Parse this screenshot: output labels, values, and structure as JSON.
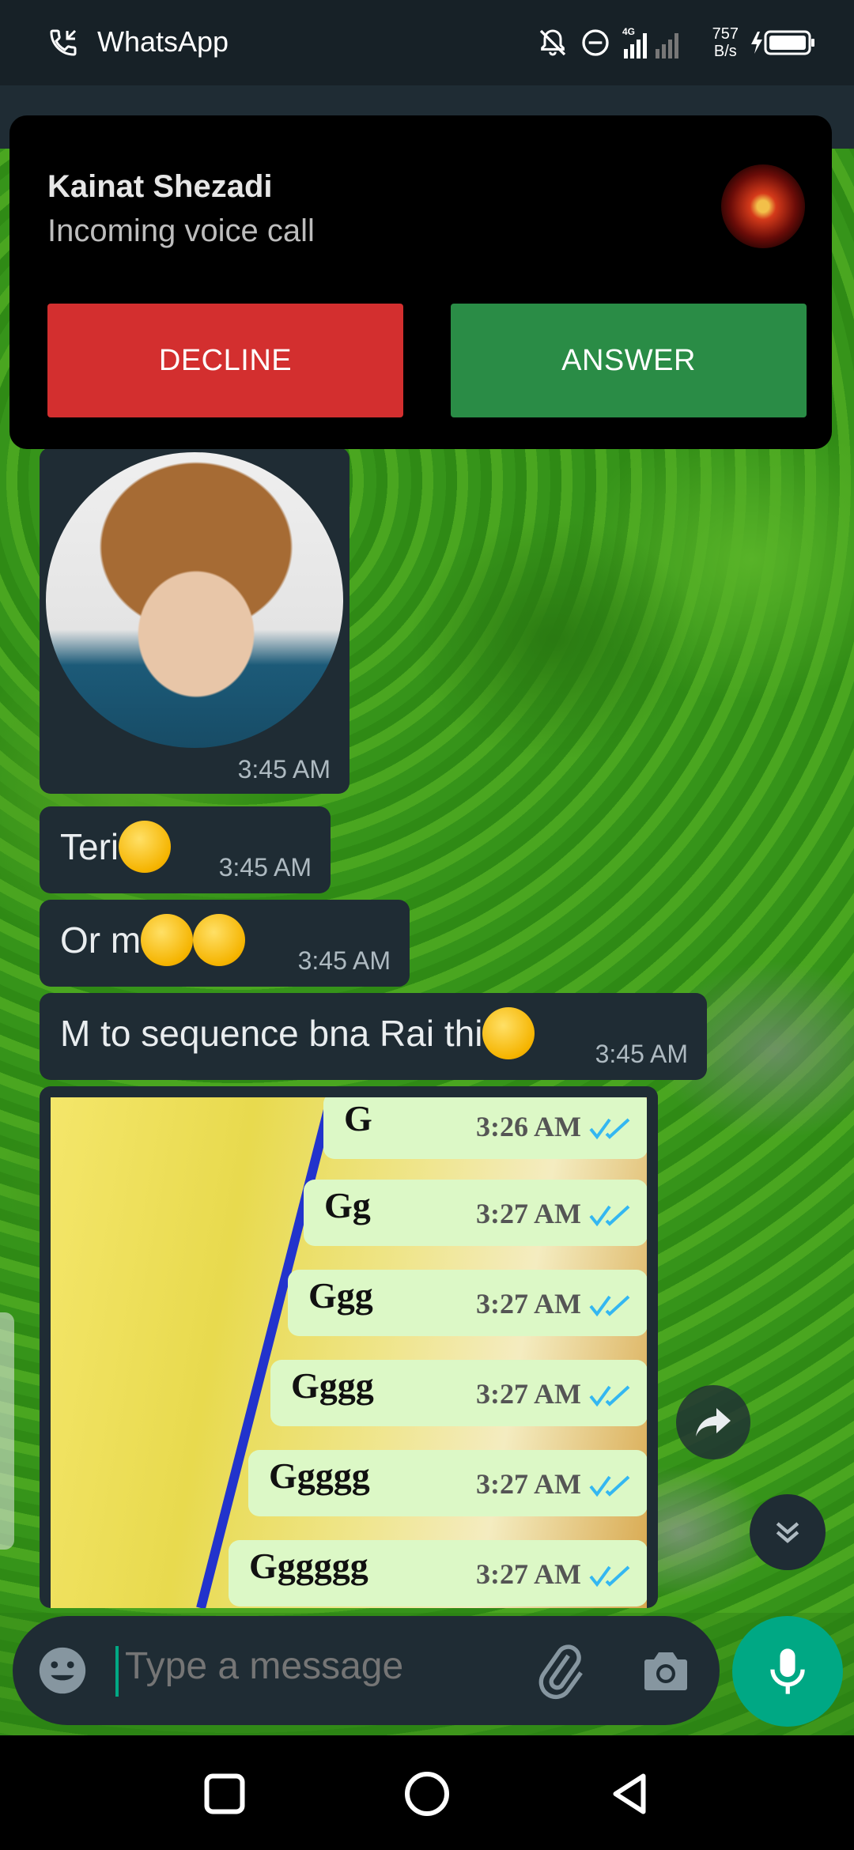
{
  "status_bar": {
    "app_name": "WhatsApp",
    "network_type": "4G",
    "net_speed_value": "757",
    "net_speed_unit": "B/s",
    "icons": [
      "missed-call-icon",
      "silent-bell-icon",
      "do-not-disturb-icon",
      "signal-icon",
      "battery-charging-icon"
    ]
  },
  "call_notification": {
    "caller_name": "Kainat Shezadi",
    "subtitle": "Incoming voice call",
    "decline_label": "DECLINE",
    "answer_label": "ANSWER",
    "colors": {
      "decline": "#d32f2f",
      "answer": "#2a8c46"
    }
  },
  "messages": [
    {
      "type": "sticker",
      "time": "3:45 AM"
    },
    {
      "type": "text",
      "text": "Teri",
      "emoji": "raised-eyebrow-emoji",
      "time": "3:45 AM"
    },
    {
      "type": "text",
      "text": "Or m",
      "emoji": "laughing-emoji",
      "time": "3:45 AM"
    },
    {
      "type": "text",
      "text": "M to sequence bna Rai thi",
      "emoji": "grinning-emoji",
      "time": "3:45 AM"
    },
    {
      "type": "image",
      "screenshot_rows": [
        {
          "text": "G",
          "time": "3:26 AM"
        },
        {
          "text": "Gg",
          "time": "3:27 AM"
        },
        {
          "text": "Ggg",
          "time": "3:27 AM"
        },
        {
          "text": "Gggg",
          "time": "3:27 AM"
        },
        {
          "text": "Ggggg",
          "time": "3:27 AM"
        },
        {
          "text": "Gggggg",
          "time": "3:27 AM"
        }
      ]
    }
  ],
  "composer": {
    "placeholder": "Type a message"
  },
  "theme": {
    "accent": "#00a884",
    "bubble": "#1f2c34",
    "read_tick": "#34b7f1"
  }
}
